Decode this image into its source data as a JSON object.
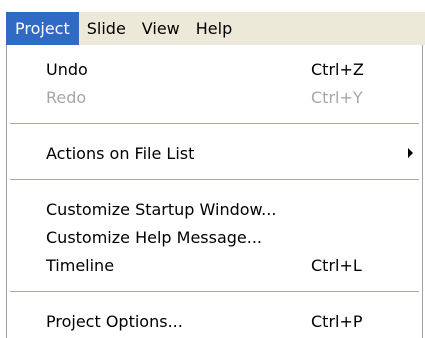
{
  "menubar": {
    "items": [
      {
        "label": "Project",
        "active": true
      },
      {
        "label": "Slide"
      },
      {
        "label": "View"
      },
      {
        "label": "Help"
      }
    ]
  },
  "menu": {
    "items": [
      {
        "label": "Undo",
        "shortcut": "Ctrl+Z",
        "enabled": true
      },
      {
        "label": "Redo",
        "shortcut": "Ctrl+Y",
        "enabled": false
      },
      {
        "label": "Actions on File List",
        "submenu": true
      },
      {
        "label": "Customize Startup Window...",
        "shortcut": ""
      },
      {
        "label": "Customize Help Message...",
        "shortcut": ""
      },
      {
        "label": "Timeline",
        "shortcut": "Ctrl+L"
      },
      {
        "label": "Project Options...",
        "shortcut": "Ctrl+P"
      }
    ]
  },
  "colors": {
    "menubar_bg": "#ece9d8",
    "highlight": "#316ac5",
    "disabled_text": "#a7a6aa"
  }
}
